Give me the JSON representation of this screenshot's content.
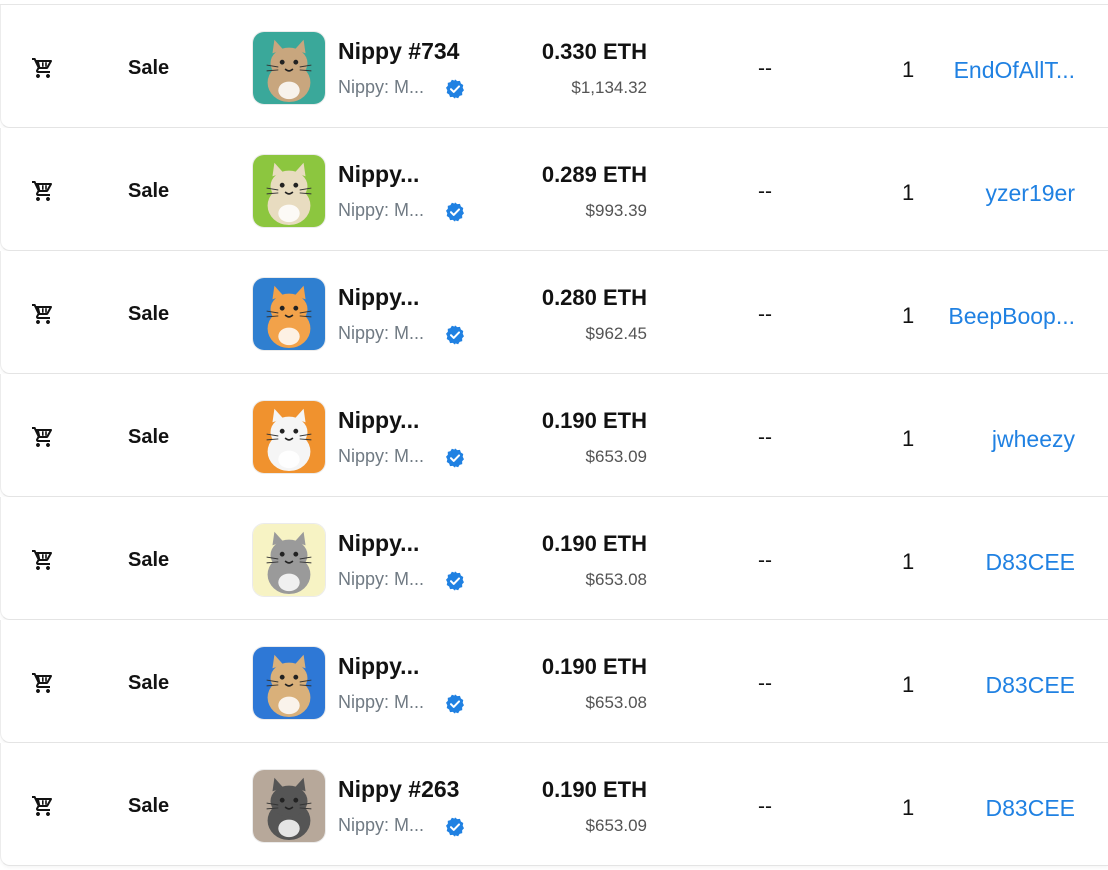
{
  "colors": {
    "link": "#2081e2",
    "verified_badge": "#2081e2",
    "muted_text": "#707a83",
    "primary_text": "#121212"
  },
  "icons": {
    "event": "shopping-cart-icon",
    "verified": "verified-badge-icon"
  },
  "rows": [
    {
      "event": "Sale",
      "item_name": "Nippy #734",
      "collection": "Nippy: M...",
      "price": "0.330 ETH",
      "usd": "$1,134.32",
      "from": "--",
      "quantity": "1",
      "to": "EndOfAllT...",
      "thumb_bg": "#3aa89a",
      "cat_color": "#c8a67e"
    },
    {
      "event": "Sale",
      "item_name": "Nippy...",
      "collection": "Nippy: M...",
      "price": "0.289 ETH",
      "usd": "$993.39",
      "from": "--",
      "quantity": "1",
      "to": "yzer19er",
      "thumb_bg": "#8cc63f",
      "cat_color": "#e8dcc0"
    },
    {
      "event": "Sale",
      "item_name": "Nippy...",
      "collection": "Nippy: M...",
      "price": "0.280 ETH",
      "usd": "$962.45",
      "from": "--",
      "quantity": "1",
      "to": "BeepBoop...",
      "thumb_bg": "#2f7fd0",
      "cat_color": "#f2a24a"
    },
    {
      "event": "Sale",
      "item_name": "Nippy...",
      "collection": "Nippy: M...",
      "price": "0.190 ETH",
      "usd": "$653.09",
      "from": "--",
      "quantity": "1",
      "to": "jwheezy",
      "thumb_bg": "#f0922e",
      "cat_color": "#f5f5f5"
    },
    {
      "event": "Sale",
      "item_name": "Nippy...",
      "collection": "Nippy: M...",
      "price": "0.190 ETH",
      "usd": "$653.08",
      "from": "--",
      "quantity": "1",
      "to": "D83CEE",
      "thumb_bg": "#f7f3c4",
      "cat_color": "#9a9a9a"
    },
    {
      "event": "Sale",
      "item_name": "Nippy...",
      "collection": "Nippy: M...",
      "price": "0.190 ETH",
      "usd": "$653.08",
      "from": "--",
      "quantity": "1",
      "to": "D83CEE",
      "thumb_bg": "#2e78d6",
      "cat_color": "#d9b07a"
    },
    {
      "event": "Sale",
      "item_name": "Nippy #263",
      "collection": "Nippy: M...",
      "price": "0.190 ETH",
      "usd": "$653.09",
      "from": "--",
      "quantity": "1",
      "to": "D83CEE",
      "thumb_bg": "#b7a89a",
      "cat_color": "#555555"
    }
  ]
}
